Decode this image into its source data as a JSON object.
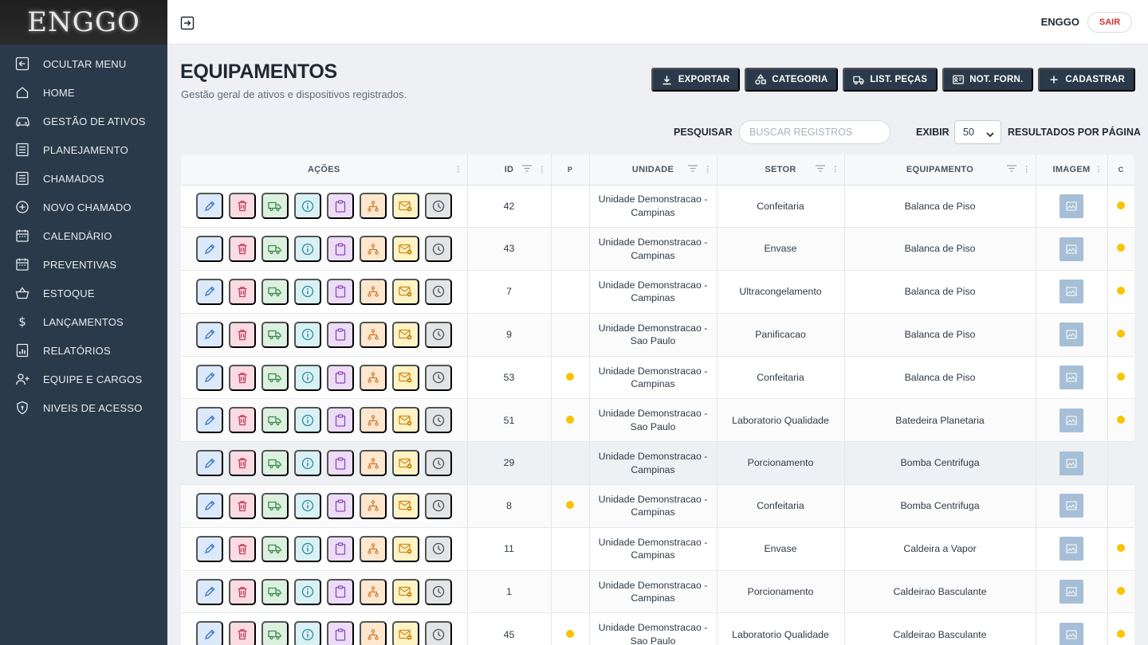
{
  "brand": {
    "logo_text": "ENGGO"
  },
  "sidebar": {
    "items": [
      {
        "label": "OCULTAR MENU",
        "icon": "collapse-icon"
      },
      {
        "label": "HOME",
        "icon": "home-icon"
      },
      {
        "label": "GESTÃO DE ATIVOS",
        "icon": "car-icon"
      },
      {
        "label": "PLANEJAMENTO",
        "icon": "list-icon"
      },
      {
        "label": "CHAMADOS",
        "icon": "list-icon"
      },
      {
        "label": "NOVO CHAMADO",
        "icon": "plus-circle-icon"
      },
      {
        "label": "CALENDÁRIO",
        "icon": "calendar-icon"
      },
      {
        "label": "PREVENTIVAS",
        "icon": "calendar-icon"
      },
      {
        "label": "ESTOQUE",
        "icon": "basket-icon"
      },
      {
        "label": "LANÇAMENTOS",
        "icon": "dollar-icon"
      },
      {
        "label": "RELATÓRIOS",
        "icon": "report-icon"
      },
      {
        "label": "EQUIPE E CARGOS",
        "icon": "user-plus-icon"
      },
      {
        "label": "NIVEIS DE ACESSO",
        "icon": "shield-icon"
      }
    ]
  },
  "topbar": {
    "user": "ENGGO",
    "logout_label": "SAIR"
  },
  "header": {
    "title": "EQUIPAMENTOS",
    "subtitle": "Gestão geral de ativos e dispositivos registrados.",
    "buttons": [
      {
        "label": "EXPORTAR",
        "icon": "download-icon"
      },
      {
        "label": "CATEGORIA",
        "icon": "shapes-icon"
      },
      {
        "label": "LIST. PEÇAS",
        "icon": "truck-icon"
      },
      {
        "label": "NOT. FORN.",
        "icon": "id-card-icon"
      },
      {
        "label": "CADASTRAR",
        "icon": "plus-icon"
      }
    ]
  },
  "search": {
    "label": "PESQUISAR",
    "placeholder": "BUSCAR REGISTROS",
    "value": "",
    "show_label": "EXIBIR",
    "page_size": "50",
    "results_label": "RESULTADOS POR PÁGINA"
  },
  "table": {
    "columns": [
      "AÇÕES",
      "ID",
      "P",
      "UNIDADE",
      "SETOR",
      "EQUIPAMENTO",
      "IMAGEM",
      "C"
    ],
    "actions": [
      "edit",
      "delete",
      "shipping",
      "info",
      "clipboard",
      "hierarchy",
      "mail",
      "history"
    ],
    "rows": [
      {
        "id": "42",
        "p": false,
        "unit": [
          "Unidade Demonstracao -",
          "Campinas"
        ],
        "sector": "Confeitaria",
        "equipment": "Balanca de Piso",
        "c": true
      },
      {
        "id": "43",
        "p": false,
        "unit": [
          "Unidade Demonstracao -",
          "Campinas"
        ],
        "sector": "Envase",
        "equipment": "Balanca de Piso",
        "c": true
      },
      {
        "id": "7",
        "p": false,
        "unit": [
          "Unidade Demonstracao -",
          "Campinas"
        ],
        "sector": "Ultracongelamento",
        "equipment": "Balanca de Piso",
        "c": true
      },
      {
        "id": "9",
        "p": false,
        "unit": [
          "Unidade Demonstracao -",
          "Sao Paulo"
        ],
        "sector": "Panificacao",
        "equipment": "Balanca de Piso",
        "c": true
      },
      {
        "id": "53",
        "p": true,
        "unit": [
          "Unidade Demonstracao -",
          "Campinas"
        ],
        "sector": "Confeitaria",
        "equipment": "Balanca de Piso",
        "c": true
      },
      {
        "id": "51",
        "p": true,
        "unit": [
          "Unidade Demonstracao -",
          "Sao Paulo"
        ],
        "sector": "Laboratorio Qualidade",
        "equipment": "Batedeira Planetaria",
        "c": true
      },
      {
        "id": "29",
        "p": false,
        "unit": [
          "Unidade Demonstracao -",
          "Campinas"
        ],
        "sector": "Porcionamento",
        "equipment": "Bomba Centrifuga",
        "c": false
      },
      {
        "id": "8",
        "p": true,
        "unit": [
          "Unidade Demonstracao -",
          "Campinas"
        ],
        "sector": "Confeitaria",
        "equipment": "Bomba Centrifuga",
        "c": false
      },
      {
        "id": "11",
        "p": false,
        "unit": [
          "Unidade Demonstracao -",
          "Campinas"
        ],
        "sector": "Envase",
        "equipment": "Caldeira a Vapor",
        "c": true
      },
      {
        "id": "1",
        "p": false,
        "unit": [
          "Unidade Demonstracao -",
          "Campinas"
        ],
        "sector": "Porcionamento",
        "equipment": "Caldeirao Basculante",
        "c": true
      },
      {
        "id": "45",
        "p": true,
        "unit": [
          "Unidade Demonstracao -",
          "Sao Paulo"
        ],
        "sector": "Laboratorio Qualidade",
        "equipment": "Caldeirao Basculante",
        "c": true
      }
    ]
  },
  "colors": {
    "sidebar": "#2b3a4a",
    "primary": "#2b3a4a",
    "status_dot": "#f8c400",
    "logout": "#d03030"
  }
}
